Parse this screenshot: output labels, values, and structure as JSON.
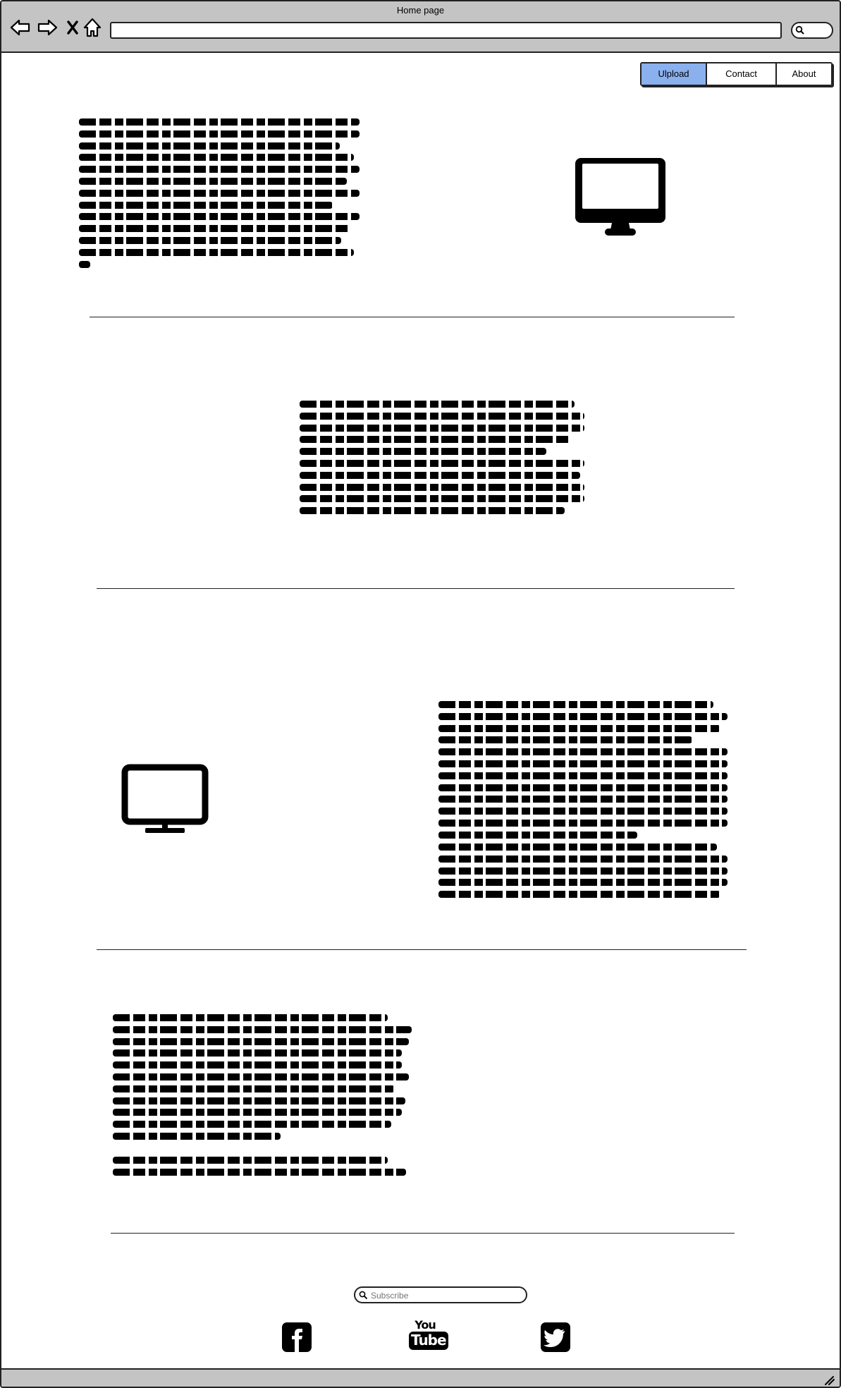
{
  "window": {
    "title": "Home page"
  },
  "toolbar": {
    "back_icon": "arrow-left-icon",
    "forward_icon": "arrow-right-icon",
    "stop_icon": "close-icon",
    "home_icon": "home-icon",
    "address_value": "",
    "search_icon": "search-icon"
  },
  "nav": {
    "tabs": [
      {
        "label": "Ulpload",
        "active": true
      },
      {
        "label": "Contact",
        "active": false
      },
      {
        "label": "About",
        "active": false
      }
    ]
  },
  "sections": [
    {
      "icon": "desktop-monitor-icon"
    },
    {
      "icon": ""
    },
    {
      "icon": "monitor-icon"
    },
    {
      "icon": ""
    }
  ],
  "footer": {
    "subscribe_placeholder": "Subscribe",
    "subscribe_icon": "search-icon",
    "social": [
      {
        "icon": "facebook-icon"
      },
      {
        "icon": "youtube-icon",
        "label_top": "You",
        "label_bottom": "Tube"
      },
      {
        "icon": "twitter-icon"
      }
    ]
  },
  "colors": {
    "chrome": "#c4c4c4",
    "active_tab": "#8bb0ee",
    "ink": "#000000"
  }
}
